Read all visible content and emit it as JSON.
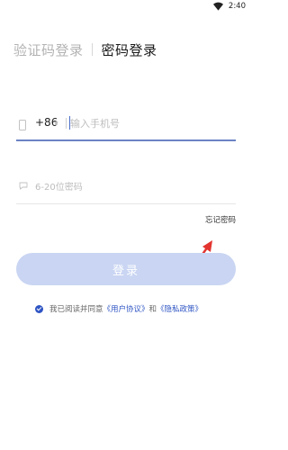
{
  "status_bar": {
    "time": "2:40"
  },
  "tabs": {
    "sms_login": "验证码登录",
    "password_login": "密码登录"
  },
  "phone": {
    "country_code": "+86",
    "placeholder": "输入手机号",
    "value": ""
  },
  "password": {
    "placeholder": "6-20位密码",
    "value": ""
  },
  "forgot_password": "忘记密码",
  "login_button": "登录",
  "agreement": {
    "checked": true,
    "prefix": "我已阅读并同意",
    "user_agreement": "《用户协议》",
    "and": "和",
    "privacy_policy": "《隐私政策》"
  },
  "colors": {
    "accent": "#2f55c4",
    "button_disabled": "#c9d5f2",
    "arrow": "#e3342f"
  }
}
